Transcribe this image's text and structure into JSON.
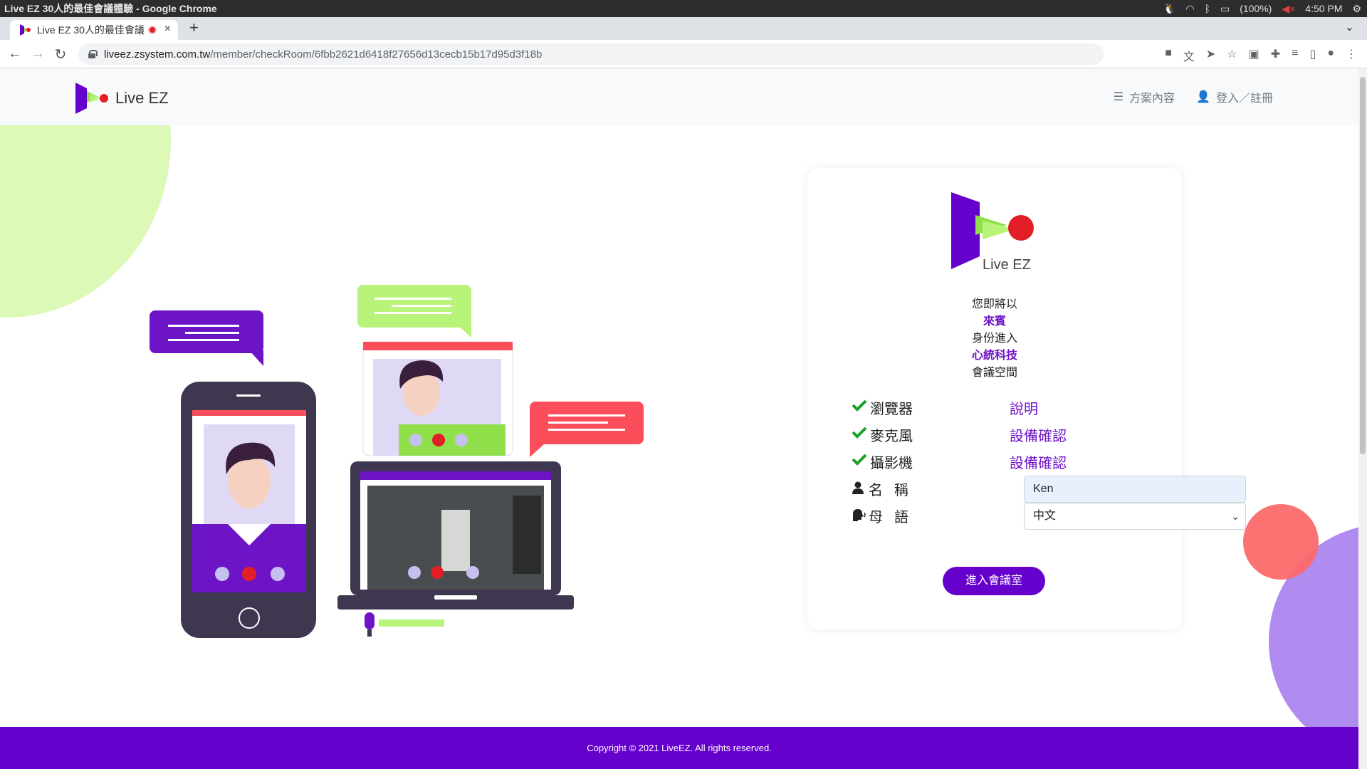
{
  "os": {
    "window_title": "Live EZ 30人的最佳會議體驗 - Google Chrome",
    "battery": "(100%)",
    "clock": "4:50 PM"
  },
  "browser": {
    "tab_title": "Live EZ 30人的最佳會議",
    "url_host": "liveez.zsystem.com.tw",
    "url_path": "/member/checkRoom/6fbb2621d6418f27656d13cecb15b17d95d3f18b"
  },
  "header": {
    "brand": "Live EZ",
    "nav": [
      {
        "label": "方案內容",
        "icon": "list-icon"
      },
      {
        "label": "登入／註冊",
        "icon": "user-icon"
      }
    ]
  },
  "card": {
    "logo_text": "Live EZ",
    "invite_lines": [
      "您即將以",
      "來賓",
      "身份進入",
      "心統科技",
      "會議空間"
    ],
    "checks": [
      {
        "label": "瀏覽器",
        "link": "說明"
      },
      {
        "label": "麥克風",
        "link": "設備確認"
      },
      {
        "label": "攝影機",
        "link": "設備確認"
      }
    ],
    "name_label": "名稱",
    "name_value": "Ken",
    "lang_label": "母語",
    "lang_value": "中文",
    "enter_button": "進入會議室"
  },
  "footer": {
    "copyright": "Copyright © 2021 LiveEZ. All rights reserved."
  },
  "colors": {
    "brand_purple": "#6600cc",
    "accent_text": "#6d14c7",
    "check_green": "#1a9e2c",
    "bubble_red": "#fb4d5a",
    "bubble_green": "#b8f47a"
  }
}
